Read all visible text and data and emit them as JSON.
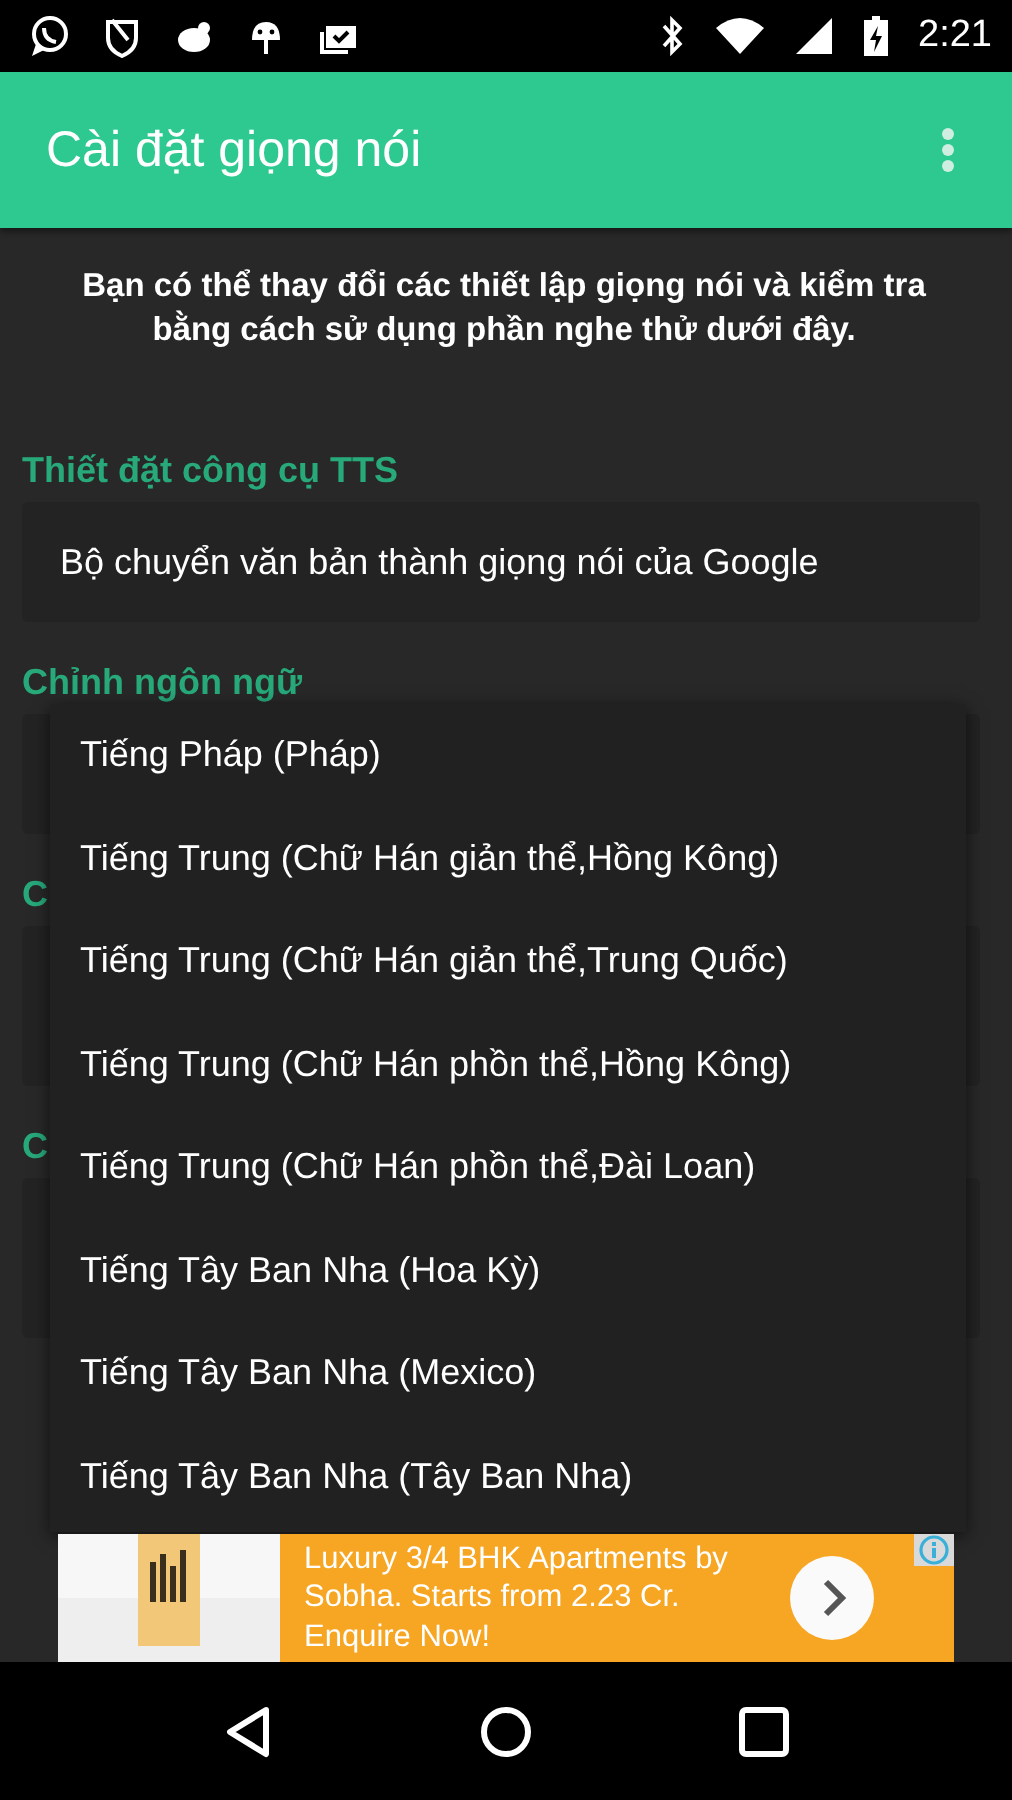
{
  "status_bar": {
    "time": "2:21"
  },
  "app_bar": {
    "title": "Cài đặt giọng nói"
  },
  "intro": "Bạn có thể thay đổi các thiết lập giọng nói và kiểm tra bằng cách sử dụng phần nghe thử dưới đây.",
  "sections": [
    {
      "heading": "Thiết đặt công cụ TTS",
      "value": "Bộ chuyển văn bản thành giọng nói của Google"
    },
    {
      "heading": "Chỉnh ngôn ngữ"
    },
    {
      "heading": "C"
    },
    {
      "heading": "C"
    }
  ],
  "dropdown": {
    "items": [
      {
        "label": "Tiếng Pháp (Pháp)"
      },
      {
        "label": "Tiếng Trung (Chữ Hán giản thể,Hồng Kông)"
      },
      {
        "label": "Tiếng Trung (Chữ Hán giản thể,Trung Quốc)"
      },
      {
        "label": "Tiếng Trung (Chữ Hán phồn thể,Hồng Kông)"
      },
      {
        "label": "Tiếng Trung (Chữ Hán phồn thể,Đài Loan)"
      },
      {
        "label": "Tiếng Tây Ban Nha (Hoa Kỳ)"
      },
      {
        "label": "Tiếng Tây Ban Nha (Mexico)"
      },
      {
        "label": "Tiếng Tây Ban Nha (Tây Ban Nha)"
      }
    ]
  },
  "ad": {
    "text": "Luxury 3/4 BHK Apartments by Sobha. Starts from 2.23 Cr. Enquire Now!"
  }
}
